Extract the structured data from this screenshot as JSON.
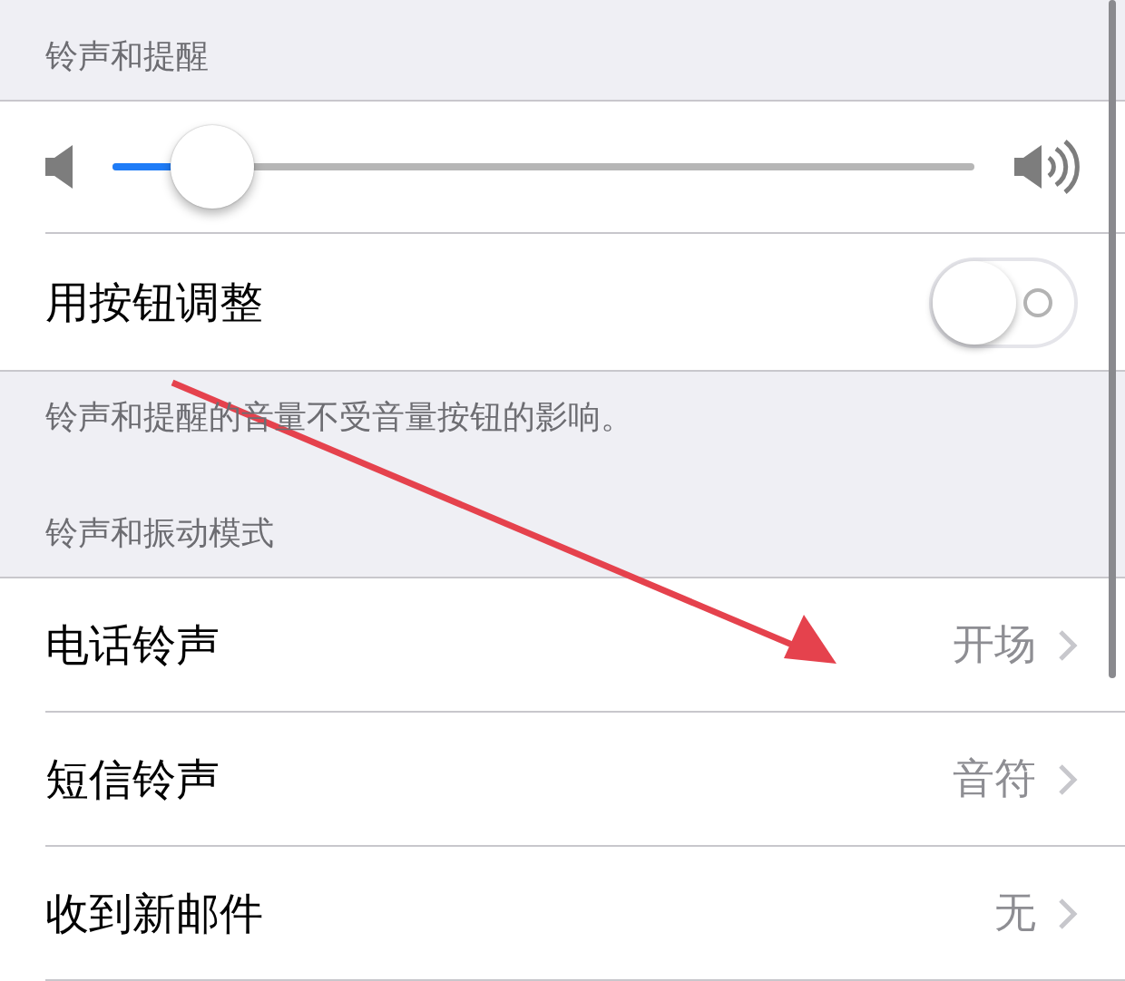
{
  "sections": [
    {
      "header": "铃声和提醒",
      "rows": [
        {
          "kind": "slider",
          "level": 0.115
        },
        {
          "kind": "toggle",
          "label": "用按钮调整",
          "on": false
        }
      ],
      "footer": "铃声和提醒的音量不受音量按钮的影响。"
    },
    {
      "header": "铃声和振动模式",
      "rows": [
        {
          "kind": "link",
          "label": "电话铃声",
          "value": "开场"
        },
        {
          "kind": "link",
          "label": "短信铃声",
          "value": "音符"
        },
        {
          "kind": "link",
          "label": "收到新邮件",
          "value": "无"
        }
      ]
    }
  ],
  "annotation": {
    "kind": "arrow"
  }
}
